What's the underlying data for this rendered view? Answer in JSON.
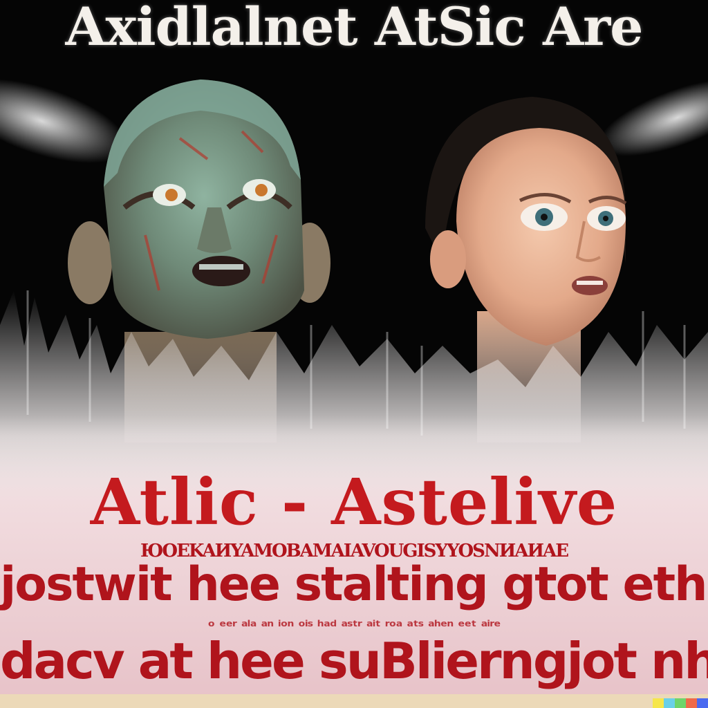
{
  "poster": {
    "top_title": "Axidlalnet AtSic Are",
    "headline": "Atlic - Astelive",
    "line_small_1": "ЮOEKAИYAMOBAMAIAVOUGISYYOSNИAИAE",
    "line_big_1": "jostwit hee stalting gtot ethe ibteiie",
    "line_small_2": "ᵒ ᵉᵉʳ ᵃˡᵃ ᵃⁿ ⁱᵒⁿ ᵒⁱˢ ʰᵃᵈ ᵃˢᵗʳ ᵃⁱᵗ ʳᵒᵃ ᵃᵗˢ ᵃʰᵉⁿ ᵉᵉᵗ ᵃⁱʳᵉ",
    "line_big_2": "dacv at hee suBlierngjot nhegrstame"
  },
  "figures": {
    "left": "weathered-statue-head",
    "right": "pale-mannequin-head"
  },
  "colors": {
    "background": "#050505",
    "headline_red": "#c41a1e",
    "text_red": "#b0141c",
    "title_white": "#f4f0ea",
    "mist": "#f2ecec",
    "strip": "#ecd9b8"
  },
  "watermark_colors": [
    "#f6e64a",
    "#6ad0e8",
    "#6fd46a",
    "#ef6a4a",
    "#4a6af0"
  ]
}
